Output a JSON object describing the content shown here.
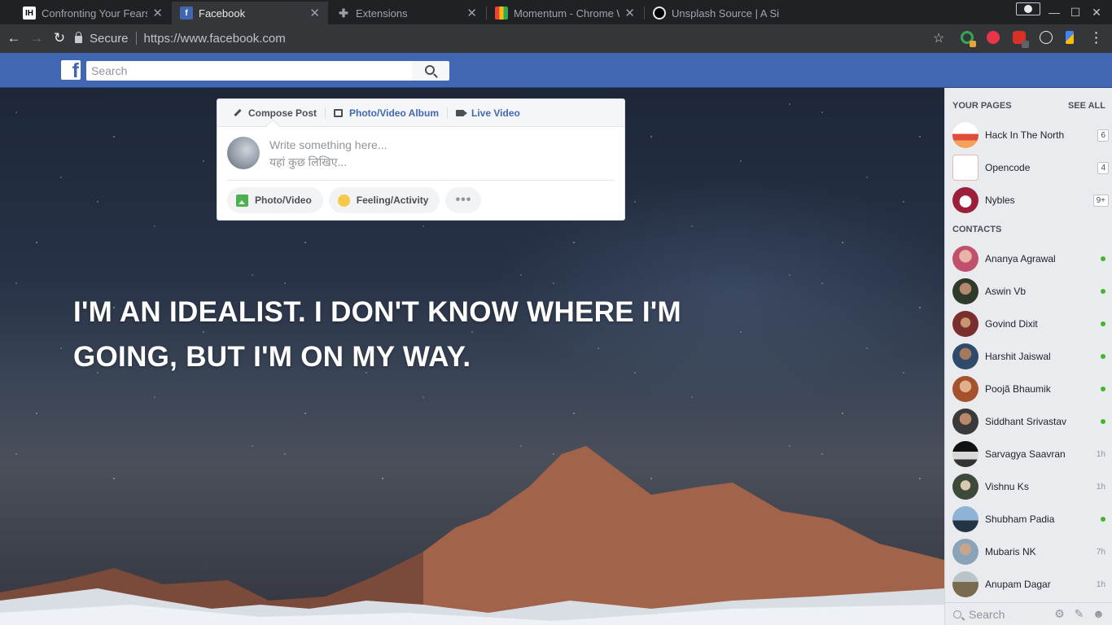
{
  "browser": {
    "tabs": [
      {
        "title": "Confronting Your Fears",
        "favicon": "ih-icon"
      },
      {
        "title": "Facebook",
        "favicon": "facebook-icon"
      },
      {
        "title": "Extensions",
        "favicon": "puzzle-icon"
      },
      {
        "title": "Momentum - Chrome W",
        "favicon": "store-icon"
      },
      {
        "title": "Unsplash Source | A Si",
        "favicon": "camera-icon"
      }
    ],
    "secure_label": "Secure",
    "url": "https://www.facebook.com"
  },
  "facebook": {
    "search_placeholder": "Search",
    "composer": {
      "tabs": [
        "Compose Post",
        "Photo/Video Album",
        "Live Video"
      ],
      "placeholder_line1": "Write something here...",
      "placeholder_line2": "यहां कुछ लिखिए...",
      "actions": [
        "Photo/Video",
        "Feeling/Activity",
        "•••"
      ]
    },
    "quote": "I'M AN IDEALIST. I DON'T KNOW WHERE I'M GOING, BUT I'M ON MY WAY."
  },
  "sidebar": {
    "pages_heading": "YOUR PAGES",
    "see_all": "SEE ALL",
    "pages": [
      {
        "name": "Hack In The North",
        "count": "6"
      },
      {
        "name": "Opencode",
        "count": "4"
      },
      {
        "name": "Nybles",
        "count": "9+"
      }
    ],
    "contacts_heading": "CONTACTS",
    "contacts": [
      {
        "name": "Ananya Agrawal",
        "status": "online"
      },
      {
        "name": "Aswin Vb",
        "status": "online"
      },
      {
        "name": "Govind Dixit",
        "status": "online"
      },
      {
        "name": "Harshit Jaiswal",
        "status": "online"
      },
      {
        "name": "Poojã Bhaumik",
        "status": "online"
      },
      {
        "name": "Siddhant Srivastav",
        "status": "online"
      },
      {
        "name": "Sarvagya Saavran",
        "status": "1h"
      },
      {
        "name": "Vishnu Ks",
        "status": "1h"
      },
      {
        "name": "Shubham Padia",
        "status": "online"
      },
      {
        "name": "Mubaris NK",
        "status": "7h"
      },
      {
        "name": "Anupam Dagar",
        "status": "1h"
      }
    ],
    "search_placeholder": "Search"
  },
  "colors": {
    "facebook_blue": "#4267b2",
    "online_green": "#42b72a"
  }
}
